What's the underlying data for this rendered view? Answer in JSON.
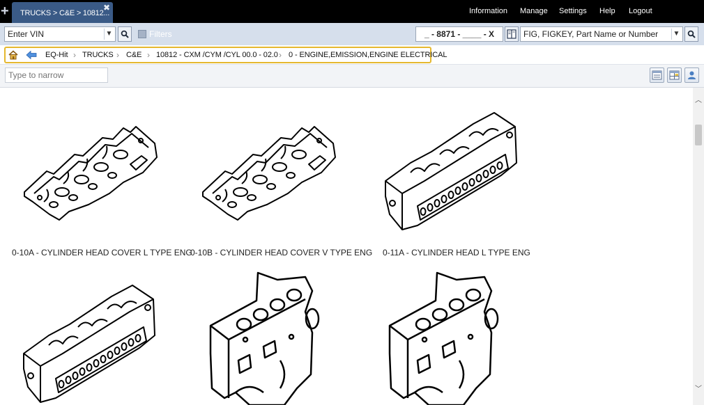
{
  "topbar": {
    "tab_label": "TRUCKS > C&E > 10812...",
    "nav": [
      "Information",
      "Manage",
      "Settings",
      "Help",
      "Logout"
    ]
  },
  "search": {
    "vin_value": "Enter VIN",
    "filters_label": "Filters",
    "code_value": "_ - 8871 - ____ - X",
    "fig_value": "FIG, FIGKEY, Part Name or Number"
  },
  "breadcrumb": [
    "EQ-Hit",
    "TRUCKS",
    "C&E",
    "10812 - CXM /CYM /CYL 00.0 - 02.0",
    "0 - ENGINE,EMISSION,ENGINE ELECTRICAL"
  ],
  "narrow": {
    "placeholder": "Type to narrow"
  },
  "cards": [
    {
      "label": "0-10A - CYLINDER HEAD COVER L TYPE ENG",
      "icon": "cylinder-head-cover-drawing"
    },
    {
      "label": "0-10B - CYLINDER HEAD COVER V TYPE ENG",
      "icon": "cylinder-head-cover-drawing"
    },
    {
      "label": "0-11A - CYLINDER HEAD L TYPE ENG",
      "icon": "cylinder-head-drawing"
    },
    {
      "label": "",
      "icon": "cylinder-head-drawing"
    },
    {
      "label": "",
      "icon": "engine-block-drawing"
    },
    {
      "label": "",
      "icon": "engine-block-drawing"
    }
  ]
}
